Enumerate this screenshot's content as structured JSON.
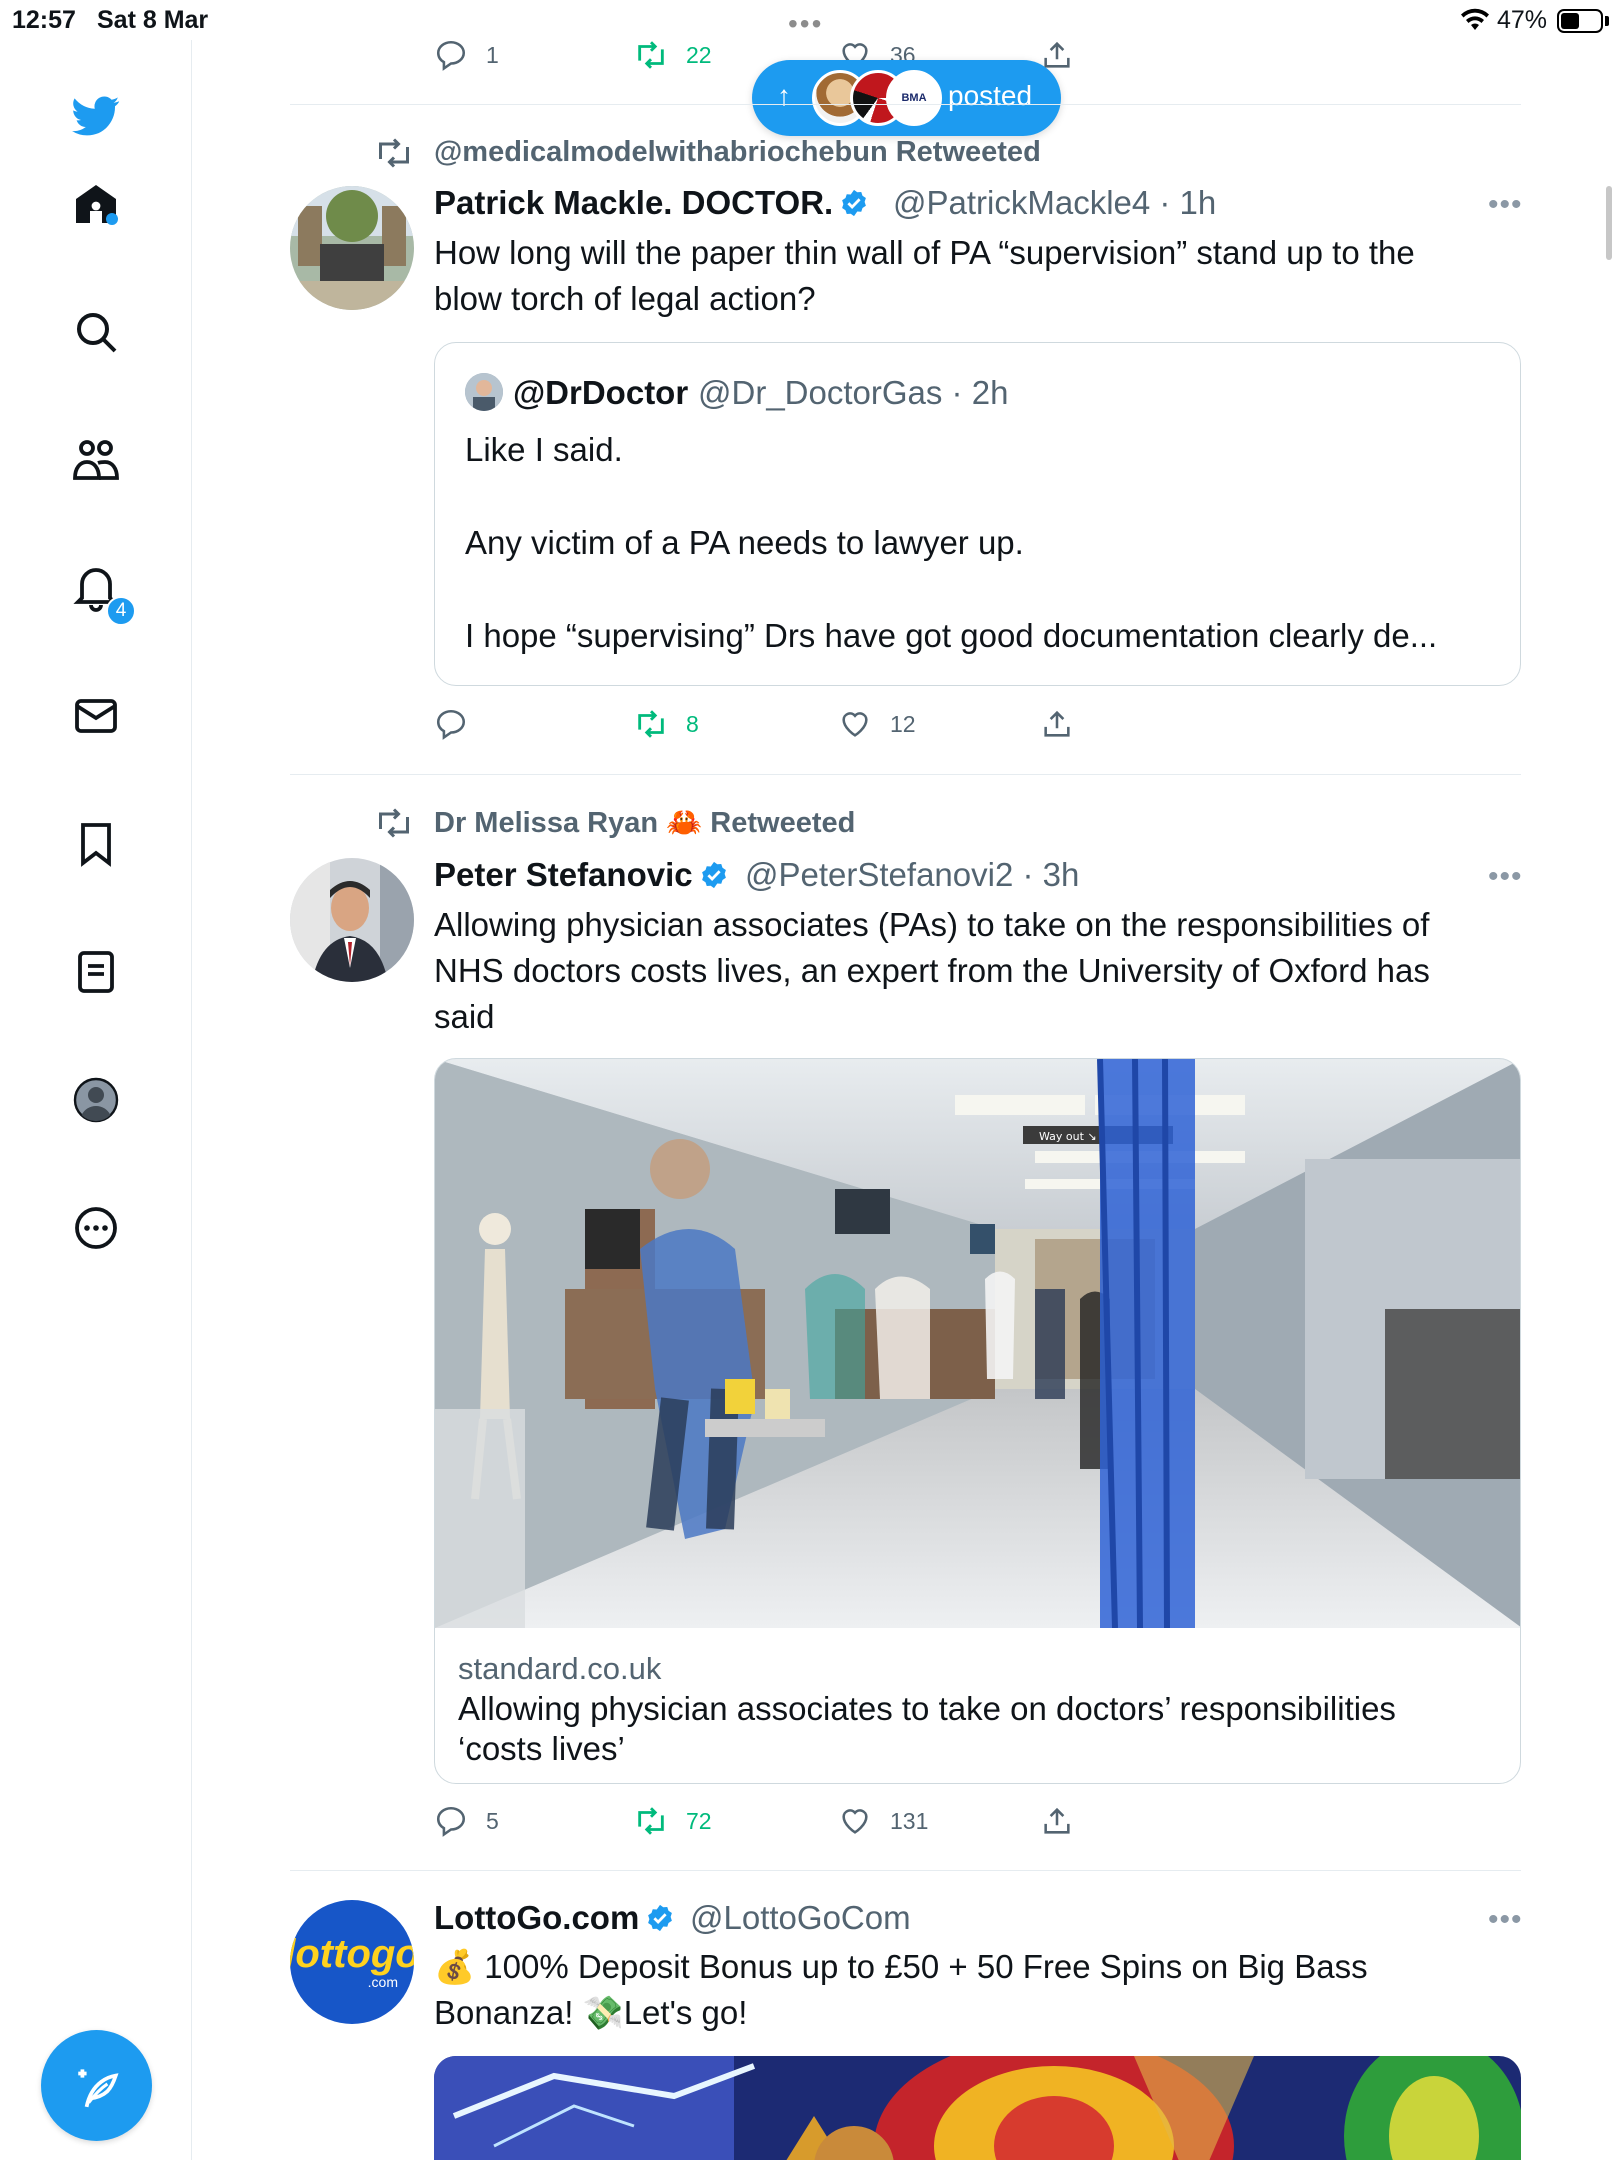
{
  "status_bar": {
    "time": "12:57",
    "date": "Sat 8 Mar",
    "battery": "47%",
    "battery_level": 0.47
  },
  "sidebar": {
    "notifications_badge": "4",
    "items": [
      "twitter-logo",
      "home-icon",
      "search-icon",
      "communities-icon",
      "notifications-icon",
      "messages-icon",
      "bookmarks-icon",
      "lists-icon",
      "profile-icon",
      "more-icon"
    ],
    "compose_icon": "compose-icon"
  },
  "new_posts_pill": {
    "label": "posted",
    "avatar_badge": "BMA"
  },
  "top_action_bar": {
    "replies": "1",
    "retweets": "22",
    "likes": "36"
  },
  "tweets": [
    {
      "retweeted_by": "@medicalmodelwithabriochebun Retweeted",
      "name": "Patrick Mackle. DOCTOR.",
      "handle": "@PatrickMackle4 · 1h",
      "text_lines": [
        "How long will the paper thin wall of PA “supervision” stand up to the",
        "blow torch of legal action?"
      ],
      "quote": {
        "name": "@DrDoctor",
        "handle": "@Dr_DoctorGas · 2h",
        "lines": [
          "Like I said.",
          "Any victim of a PA needs to lawyer up.",
          "I hope “supervising” Drs have got good documentation clearly de..."
        ]
      },
      "actions": {
        "replies": "",
        "retweets": "8",
        "likes": "12"
      }
    },
    {
      "retweeted_by_name": "Dr Melissa Ryan",
      "retweeted_by_emoji": "🦀",
      "retweeted_label": "Retweeted",
      "name": "Peter Stefanovic",
      "handle": "@PeterStefanovi2 · 3h",
      "text_lines": [
        "Allowing physician associates (PAs) to take on the responsibilities of",
        "NHS doctors costs lives, an expert from the University of Oxford has",
        "said"
      ],
      "card": {
        "image_sign": "Way out",
        "domain": "standard.co.uk",
        "title_lines": [
          "Allowing physician associates to take on doctors’ responsibilities",
          "‘costs lives’"
        ]
      },
      "actions": {
        "replies": "5",
        "retweets": "72",
        "likes": "131"
      }
    },
    {
      "name": "LottoGo.com",
      "handle": "@LottoGoCom",
      "logo_text": "lottogo",
      "logo_sub": ".com",
      "text_lines": [
        "💰 100% Deposit Bonus up to £50 + 50 Free Spins on Big Bass",
        "Bonanza! 💸Let's go!"
      ]
    }
  ],
  "colors": {
    "accent": "#1d9bf0",
    "retweet_green": "#00ba7c",
    "secondary_text": "#536471",
    "divider": "#e6ecf0"
  }
}
